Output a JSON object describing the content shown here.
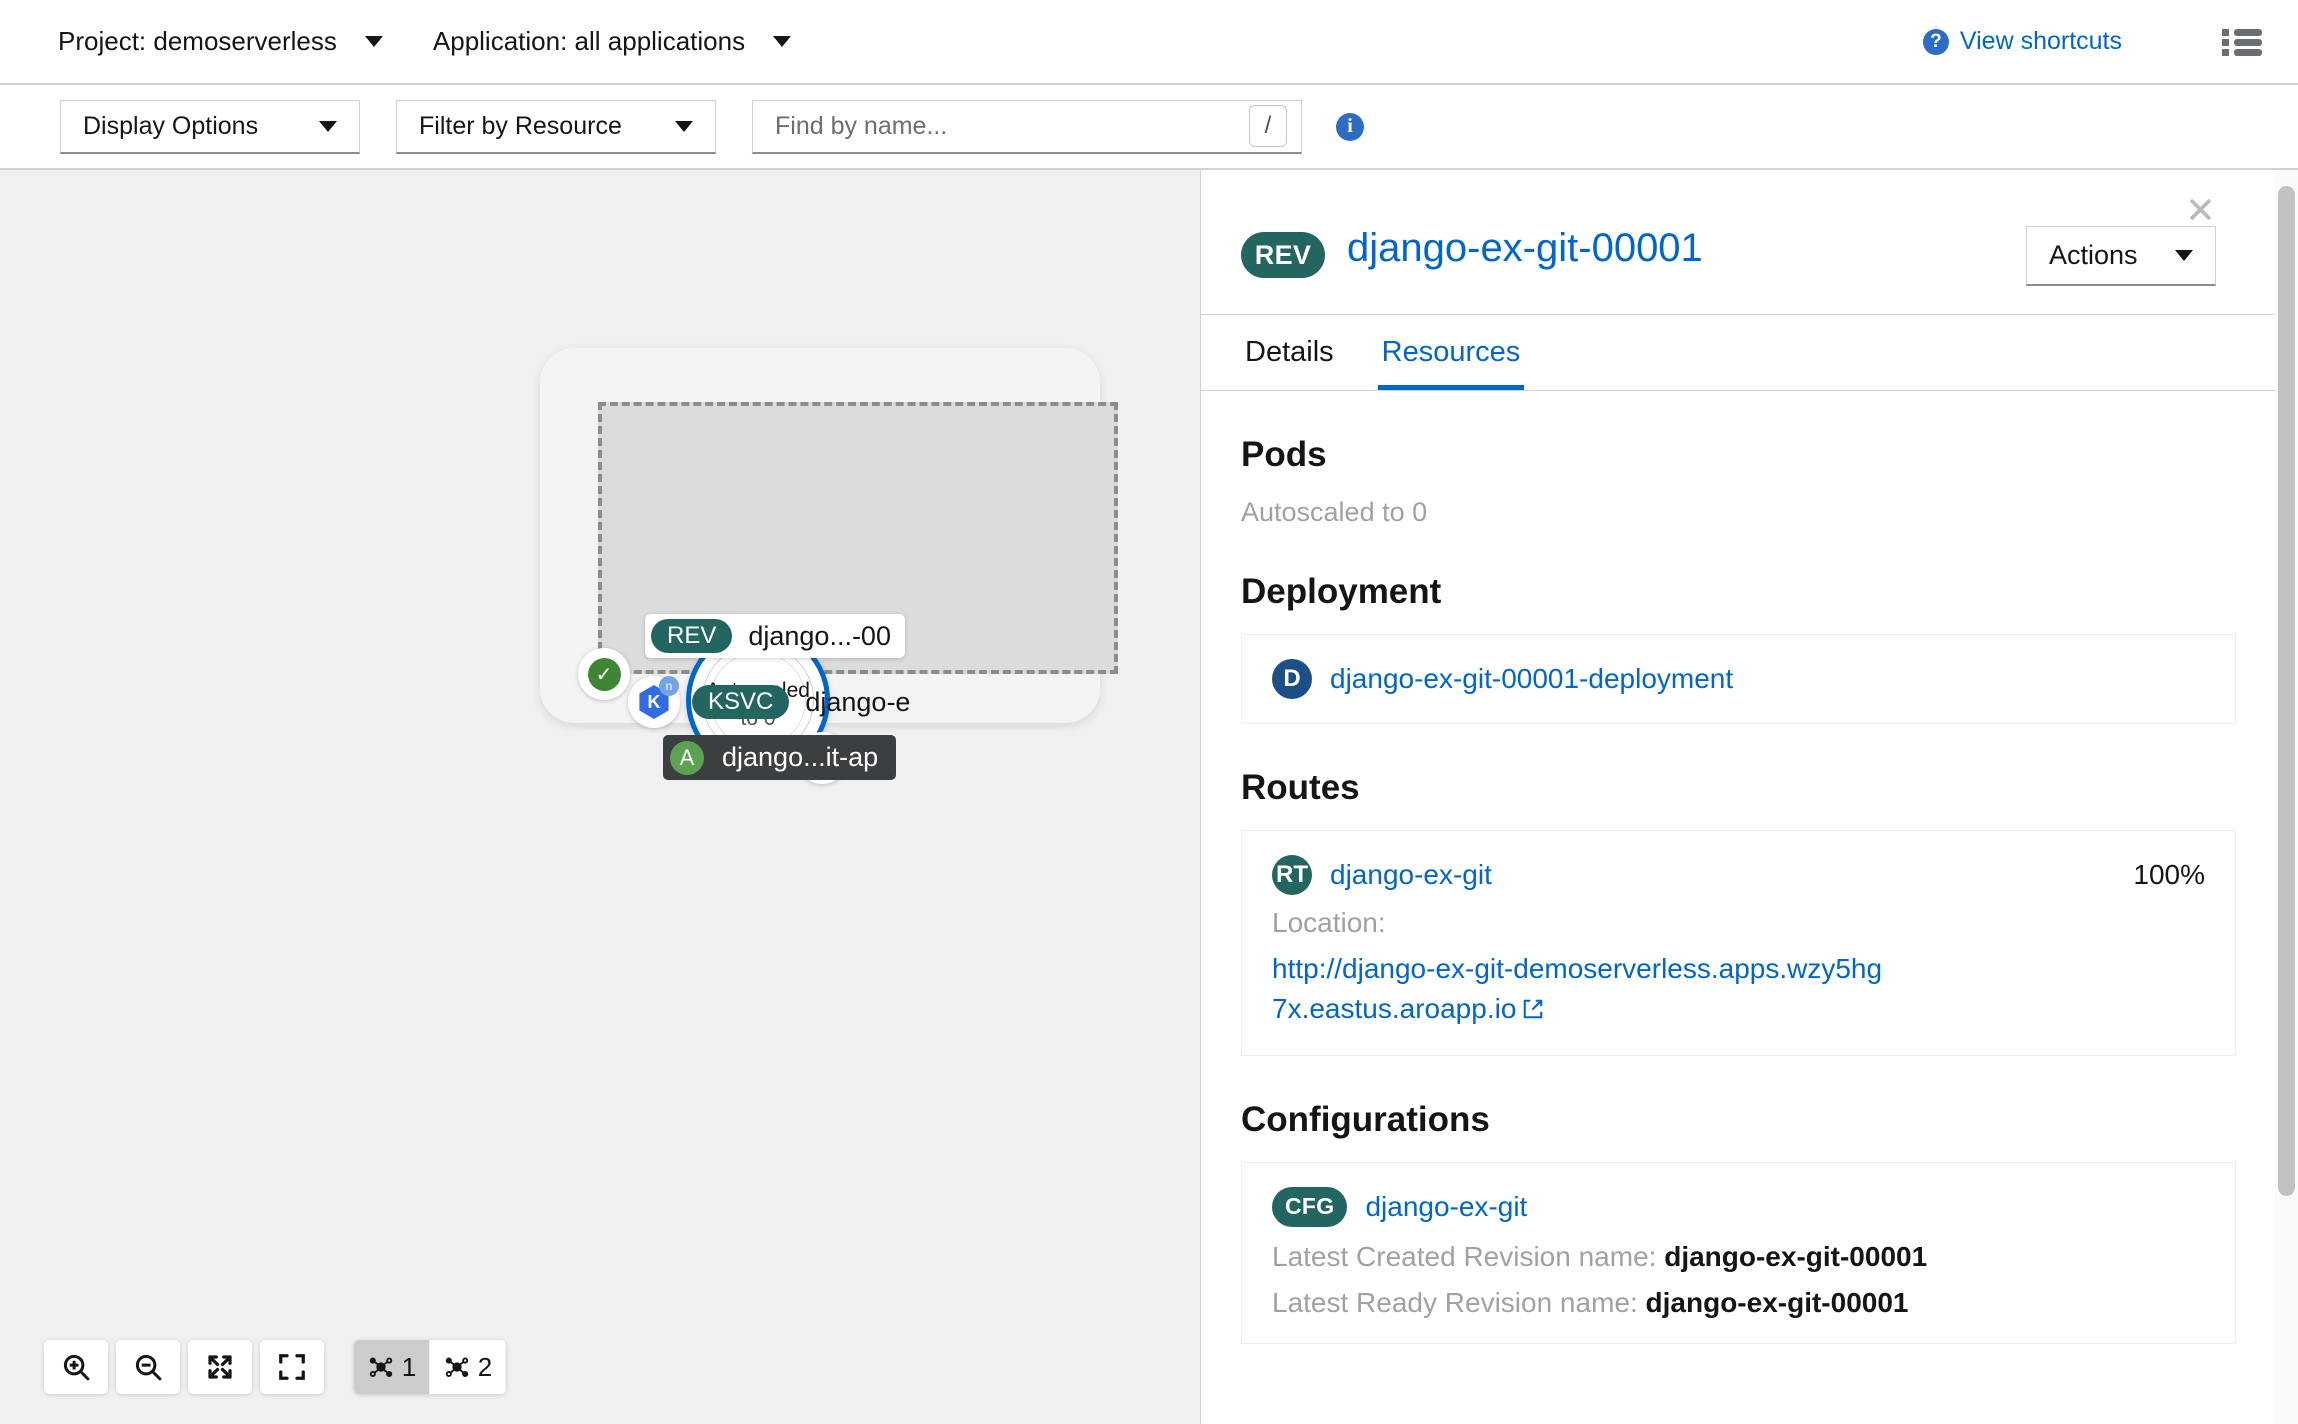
{
  "topbar": {
    "project_label": "Project: demoserverless",
    "application_label": "Application: all applications",
    "shortcuts_label": "View shortcuts",
    "shortcuts_icon": "question-circle-icon",
    "list_view_icon": "list-view-icon"
  },
  "toolbar": {
    "display_options": "Display Options",
    "filter_by_resource": "Filter by Resource",
    "search_placeholder": "Find by name...",
    "search_value": "",
    "slash_hint": "/",
    "info_icon": "info-icon"
  },
  "topology": {
    "knative_circle": {
      "line1": "Autoscaled",
      "line2": "to 0",
      "ring_color": "#0066cc",
      "source_icon": "github-icon"
    },
    "revision_chip": {
      "badge": "REV",
      "label": "django...-00"
    },
    "ksvc_row": {
      "badge": "KSVC",
      "label": "django-e",
      "k8s_icon": "kubernetes-icon",
      "k8s_sub": "n"
    },
    "app_chip": {
      "avatar": "A",
      "label": "django...it-ap"
    },
    "status_icon": "check-circle-icon"
  },
  "controls": {
    "zoom_in_icon": "zoom-in-icon",
    "zoom_out_icon": "zoom-out-icon",
    "fit_icon": "expand-arrows-icon",
    "reset_icon": "fit-to-screen-icon",
    "view_1": "1",
    "view_2": "2",
    "active_view": "1"
  },
  "panel": {
    "close_icon": "close-icon",
    "badge": "REV",
    "title": "django-ex-git-00001",
    "actions_label": "Actions",
    "tabs": [
      {
        "label": "Details",
        "active": false
      },
      {
        "label": "Resources",
        "active": true
      }
    ],
    "sections": {
      "pods": {
        "heading": "Pods",
        "empty_text": "Autoscaled to 0"
      },
      "deployment": {
        "heading": "Deployment",
        "badge": "D",
        "badge_color": "#1c4f87",
        "name": "django-ex-git-00001-deployment"
      },
      "routes": {
        "heading": "Routes",
        "badge": "RT",
        "badge_color": "#236661",
        "name": "django-ex-git",
        "percent": "100%",
        "location_label": "Location:",
        "url": "http://django-ex-git-demoserverless.apps.wzy5hg7x.eastus.aroapp.io",
        "external_icon": "external-link-icon"
      },
      "configurations": {
        "heading": "Configurations",
        "badge": "CFG",
        "badge_color": "#236661",
        "name": "django-ex-git",
        "latest_created_label": "Latest Created Revision name:",
        "latest_created_value": "django-ex-git-00001",
        "latest_ready_label": "Latest Ready Revision name:",
        "latest_ready_value": "django-ex-git-00001"
      }
    }
  },
  "colors": {
    "link": "#0066cc",
    "teal_badge": "#236661",
    "canvas_bg": "#f0f0f0",
    "border": "#d2d2d2"
  }
}
